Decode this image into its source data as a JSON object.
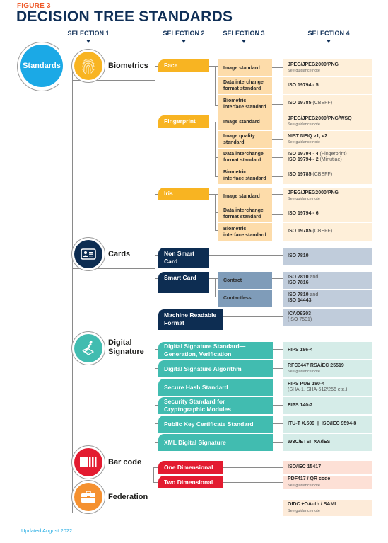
{
  "figure_label": "FIGURE 3",
  "title": "DECISION TREE STANDARDS",
  "selection_headers": [
    "SELECTION 1",
    "SELECTION 2",
    "SELECTION 3",
    "SELECTION 4"
  ],
  "root": {
    "label": "Standards",
    "color": "#1ba9e6"
  },
  "colors": {
    "biometrics": "#f8b422",
    "biometrics_s2": "#f8b422",
    "biometrics_s3": "#fddcaa",
    "biometrics_s4": "#feefd9",
    "cards": "#0d2d52",
    "cards_s2": "#0d2d52",
    "cards_s3": "#7f9cb9",
    "cards_s4": "#c0ccdb",
    "digsig": "#41bcb0",
    "digsig_s2": "#41bcb0",
    "digsig_s4": "#d5ece8",
    "barcode": "#e31b30",
    "barcode_s2": "#e31b30",
    "barcode_s4": "#fde0d6",
    "federation": "#f59130",
    "federation_s4": "#fdebd9",
    "connector": "#8a8a8a"
  },
  "categories": {
    "biometrics": {
      "label": "Biometrics",
      "icon": "fingerprint-icon",
      "face": {
        "label": "Face",
        "items": [
          {
            "s3": "Image standard",
            "s4_main": "JPEG/JPEG2000/PNG",
            "s4_note": "See guidance note"
          },
          {
            "s3": "Data interchange format standard",
            "s4_main": "ISO 19794 - 5"
          },
          {
            "s3": "Biometric interface standard",
            "s4_main": "ISO 19785",
            "s4_light": "(CBEFF)"
          }
        ]
      },
      "fingerprint": {
        "label": "Fingerprint",
        "items": [
          {
            "s3": "Image standard",
            "s4_main": "JPEG/JPEG2000/PNG/WSQ",
            "s4_note": "See guidance note"
          },
          {
            "s3": "Image quality standard",
            "s4_main": "NIST NFIQ v1, v2",
            "s4_note": "See guidance note"
          },
          {
            "s3": "Data interchange format standard",
            "s4_main": "ISO 19794 - 4",
            "s4_light": "(Fingerprint)",
            "s4_main2": "ISO 19794 - 2",
            "s4_light2": "(Minutiae)"
          },
          {
            "s3": "Biometric interface standard",
            "s4_main": "ISO 19785",
            "s4_light": "(CBEFF)"
          }
        ]
      },
      "iris": {
        "label": "Iris",
        "items": [
          {
            "s3": "Image standard",
            "s4_main": "JPEG/JPEG2000/PNG",
            "s4_note": "See guidance note"
          },
          {
            "s3": "Data interchange format standard",
            "s4_main": "ISO 19794 - 6"
          },
          {
            "s3": "Biometric interface standard",
            "s4_main": "ISO 19785",
            "s4_light": "(CBEFF)"
          }
        ]
      }
    },
    "cards": {
      "label": "Cards",
      "icon": "id-card-icon",
      "non_smart": {
        "label": "Non Smart Card",
        "s4_main": "ISO 7810"
      },
      "smart": {
        "label": "Smart Card",
        "contact": {
          "s3": "Contact",
          "s4_main": "ISO 7810",
          "s4_light": "and",
          "s4_main2": "ISO 7816"
        },
        "contactless": {
          "s3": "Contactless",
          "s4_main": "ISO 7810",
          "s4_light": "and",
          "s4_main2": "ISO 14443"
        }
      },
      "mrf": {
        "label": "Machine Readable Format",
        "s4_main": "ICAO9303",
        "s4_light": "(ISO 7501)"
      }
    },
    "digital_signature": {
      "label": "Digital Signature",
      "icon": "signature-pen-icon",
      "items": [
        {
          "s2": "Digital Signature Standard—Generation, Verification",
          "s4_main": "FIPS 186-4"
        },
        {
          "s2": "Digital Signature Algorithm",
          "s4_main": "RFC3447 RSA/EC 25519",
          "s4_note": "See guidance note"
        },
        {
          "s2": "Secure Hash Standard",
          "s4_main": "FIPS PUB 180-4",
          "s4_light": "(SHA-1, SHA-512/256 etc.)"
        },
        {
          "s2": "Security Standard for Cryptographic Modules",
          "s4_main": "FIPS 140-2"
        },
        {
          "s2": "Public Key Certificate Standard",
          "s4_main": "ITU-T X.509  |  ISO/IEC 9594-8"
        },
        {
          "s2": "XML Digital Signature",
          "s4_main": "W3C/ETSI  XAdES"
        }
      ]
    },
    "barcode": {
      "label": "Bar code",
      "icon": "barcode-icon",
      "items": [
        {
          "s2": "One Dimensional",
          "s4_main": "ISO/IEC 15417"
        },
        {
          "s2": "Two Dimensional",
          "s4_main": "PDF417 / QR code",
          "s4_note": "See guidance note"
        }
      ]
    },
    "federation": {
      "label": "Federation",
      "icon": "briefcase-icon",
      "s4_main": "OIDC +OAuth / SAML",
      "s4_note": "See guidance note"
    }
  },
  "footer": "Updated August 2022"
}
